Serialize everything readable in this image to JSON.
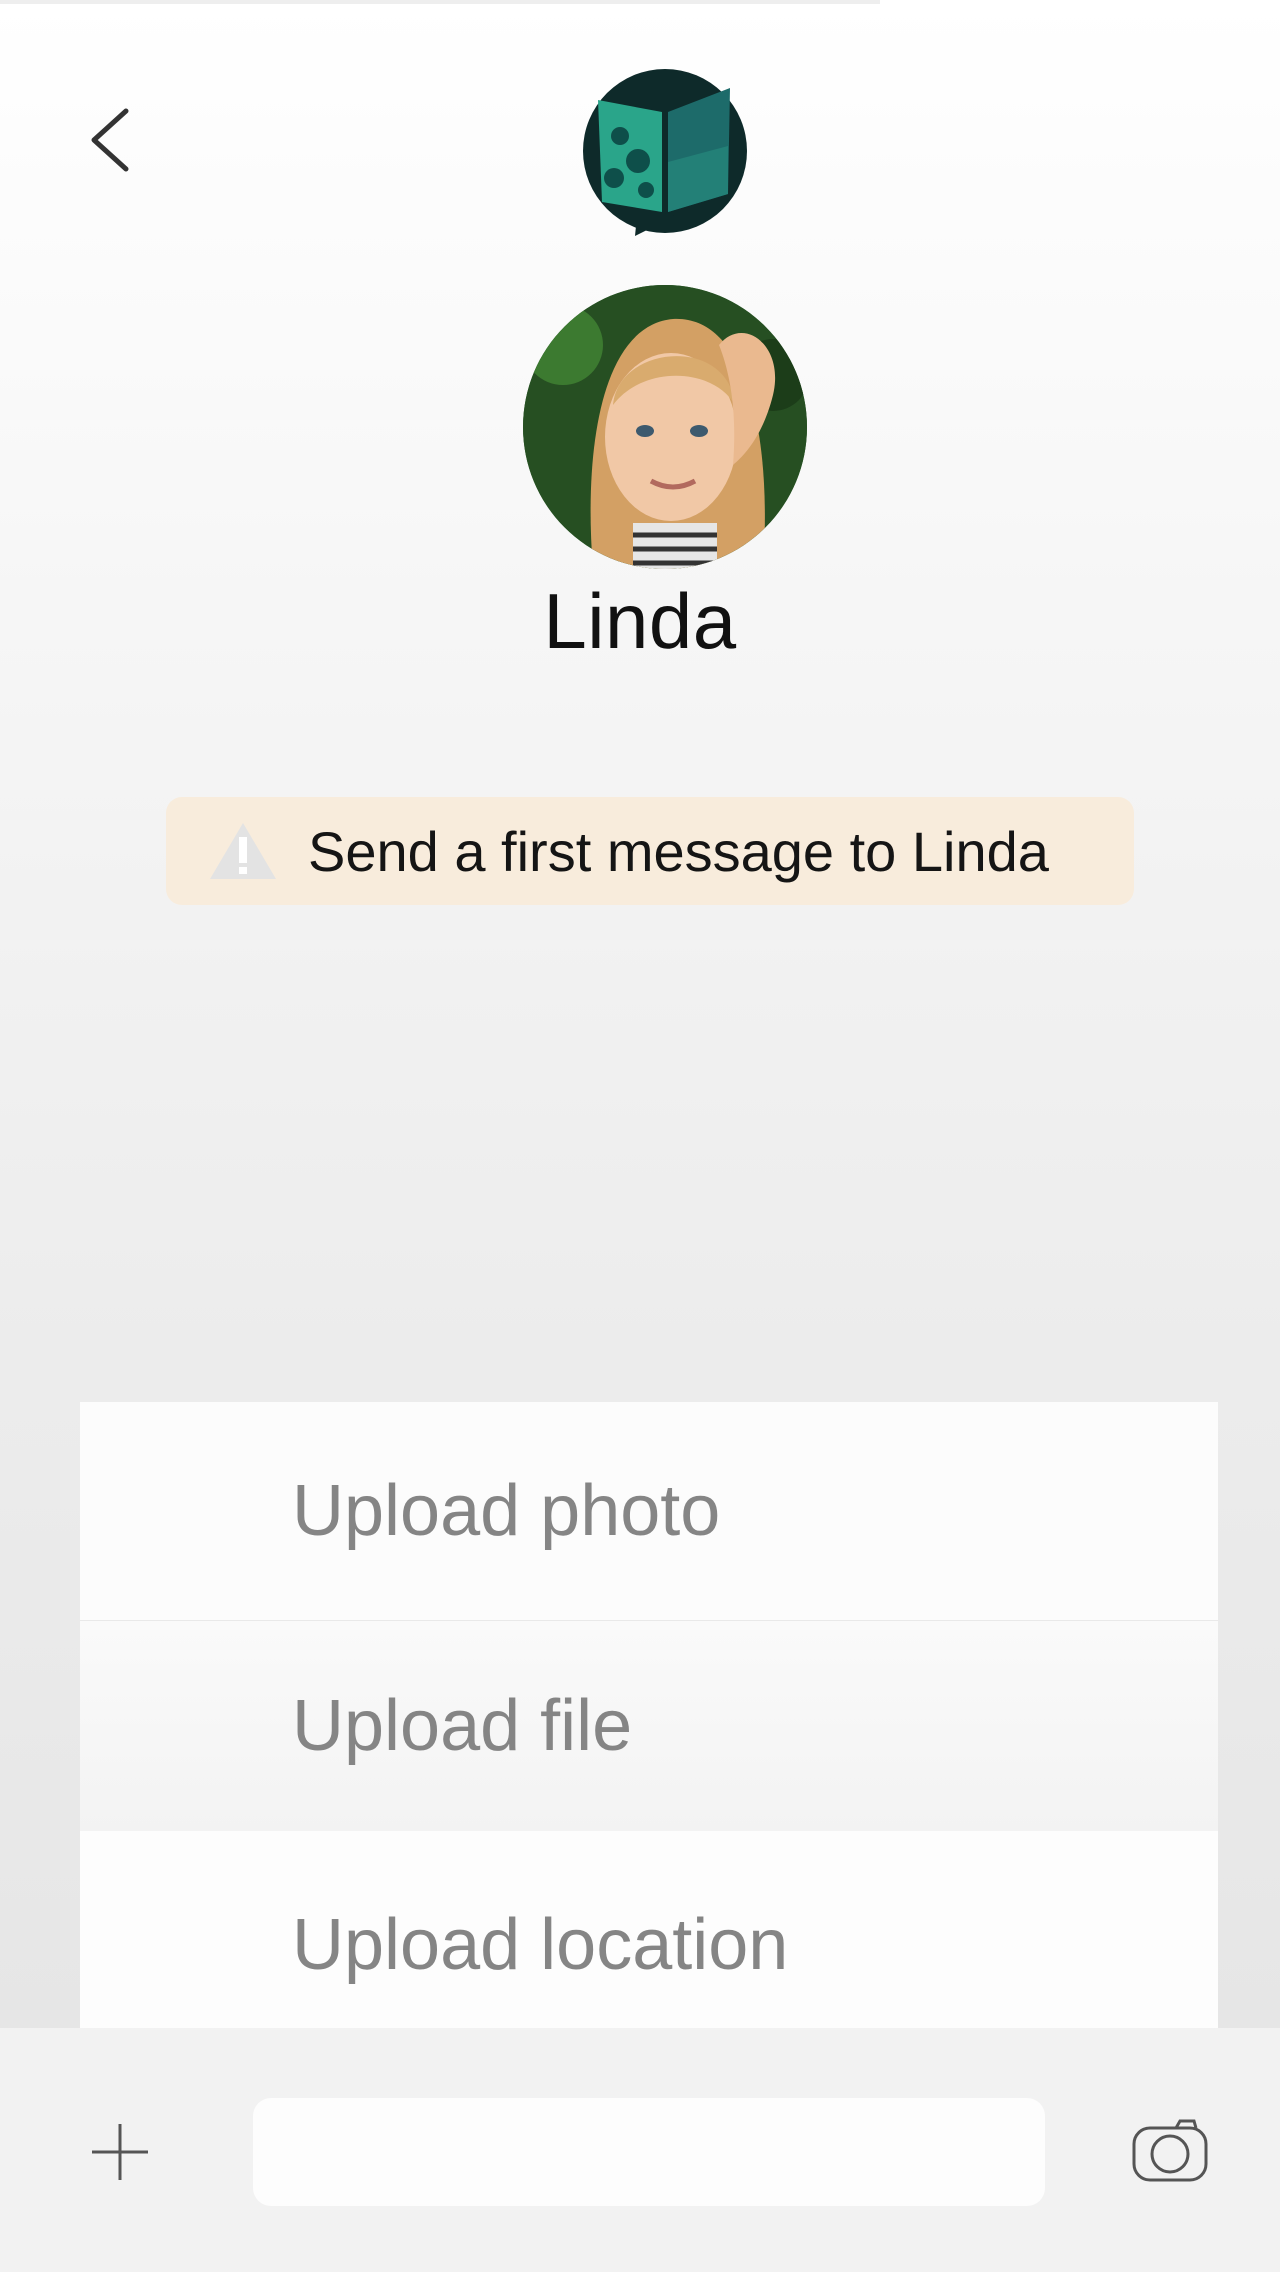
{
  "header": {
    "back_icon": "chevron-left-icon",
    "logo_icon": "app-logo-icon"
  },
  "contact": {
    "name": "Linda",
    "avatar_icon": "profile-photo"
  },
  "notice": {
    "icon": "warning-icon",
    "text": "Send a first message to Linda",
    "background": "#f8ecdc"
  },
  "attach_menu": {
    "items": [
      {
        "label": "Upload photo"
      },
      {
        "label": "Upload file"
      },
      {
        "label": "Upload location"
      }
    ]
  },
  "composer": {
    "plus_icon": "plus-icon",
    "input_value": "",
    "camera_icon": "camera-icon"
  },
  "colors": {
    "logo_teal": "#2aa58a",
    "logo_dark": "#0e2a2a",
    "menu_text": "#858585"
  }
}
